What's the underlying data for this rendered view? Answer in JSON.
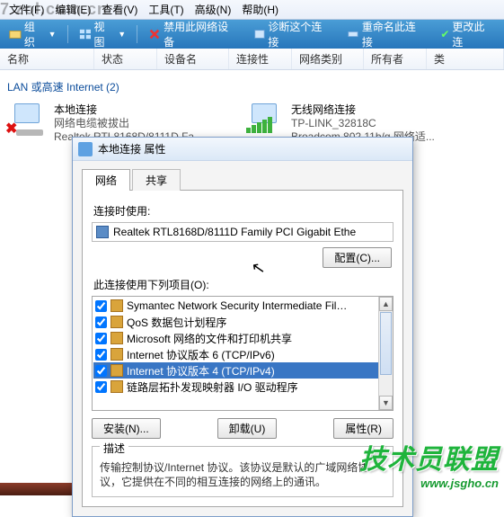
{
  "watermark_tl": "7 zol.com.cn",
  "menubar": [
    "文件(F)",
    "编辑(E)",
    "查看(V)",
    "工具(T)",
    "高级(N)",
    "帮助(H)"
  ],
  "toolbar": {
    "organize": "组织",
    "view": "视图",
    "disable": "禁用此网络设备",
    "diagnose": "诊断这个连接",
    "rename": "重命名此连接",
    "change": "更改此连"
  },
  "columns": [
    "名称",
    "状态",
    "设备名",
    "连接性",
    "网络类别",
    "所有者",
    "类"
  ],
  "group_header": "LAN 或高速 Internet (2)",
  "items": [
    {
      "title": "本地连接",
      "line2": "网络电缆被拔出",
      "line3": "Realtek RTL8168D/8111D Fa..."
    },
    {
      "title": "无线网络连接",
      "line2": "TP-LINK_32818C",
      "line3": "Broadcom 802.11b/g 网络适..."
    }
  ],
  "dialog": {
    "title": "本地连接 属性",
    "tabs": [
      "网络",
      "共享"
    ],
    "connect_using_label": "连接时使用:",
    "adapter": "Realtek RTL8168D/8111D Family PCI Gigabit Ethe",
    "configure_btn": "配置(C)...",
    "items_label": "此连接使用下列项目(O):",
    "protocol_items": [
      {
        "label": "Symantec Network Security Intermediate Fil…",
        "checked": true
      },
      {
        "label": "QoS 数据包计划程序",
        "checked": true
      },
      {
        "label": "Microsoft 网络的文件和打印机共享",
        "checked": true
      },
      {
        "label": "Internet 协议版本 6 (TCP/IPv6)",
        "checked": true
      },
      {
        "label": "Internet 协议版本 4 (TCP/IPv4)",
        "checked": true,
        "selected": true
      },
      {
        "label": "链路层拓扑发现映射器 I/O 驱动程序",
        "checked": true
      }
    ],
    "install_btn": "安装(N)...",
    "uninstall_btn": "卸载(U)",
    "properties_btn": "属性(R)",
    "desc_label": "描述",
    "desc_text": "传输控制协议/Internet 协议。该协议是默认的广域网络协议，它提供在不同的相互连接的网络上的通讯。"
  },
  "watermark_br": {
    "text": "技术员联盟",
    "url": "www.jsgho.cn"
  }
}
